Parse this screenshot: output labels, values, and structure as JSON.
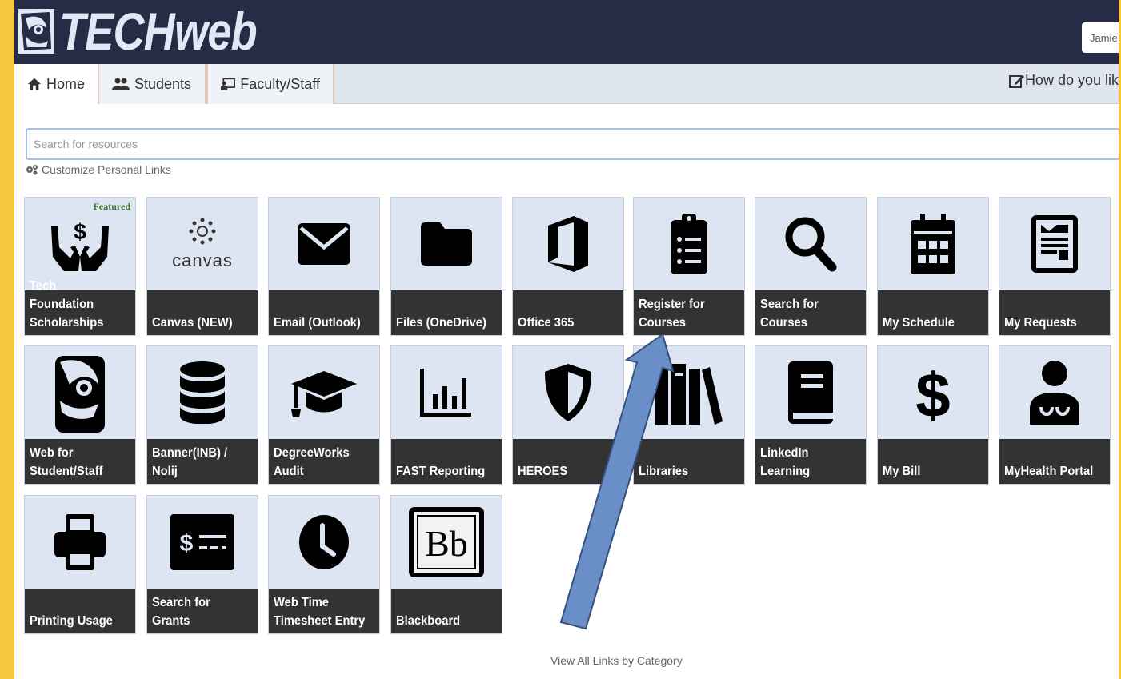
{
  "header": {
    "logo_text": "TECHweb",
    "user_label": "Jamie"
  },
  "nav": {
    "tabs": [
      {
        "label": "Home",
        "icon": "home-icon",
        "active": true
      },
      {
        "label": "Students",
        "icon": "users-icon",
        "active": false
      },
      {
        "label": "Faculty/Staff",
        "icon": "chalkboard-icon",
        "active": false
      }
    ],
    "feedback_label": "How do you lik"
  },
  "search": {
    "placeholder": "Search for resources"
  },
  "customize_label": "Customize Personal Links",
  "tiles": [
    {
      "label": "Tech Foundation\nScholarships",
      "icon": "hands-dollar-icon",
      "badge": "Featured"
    },
    {
      "label": "Canvas (NEW)",
      "icon": "canvas-logo-icon",
      "sub": "canvas"
    },
    {
      "label": "Email (Outlook)",
      "icon": "envelope-icon"
    },
    {
      "label": "Files (OneDrive)",
      "icon": "folder-icon"
    },
    {
      "label": "Office 365",
      "icon": "office-icon"
    },
    {
      "label": "Register for\nCourses",
      "icon": "clipboard-list-icon"
    },
    {
      "label": "Search for\nCourses",
      "icon": "magnifier-icon"
    },
    {
      "label": "My Schedule",
      "icon": "calendar-icon"
    },
    {
      "label": "My Requests",
      "icon": "form-icon"
    },
    {
      "label": "Web for\nStudent/Staff",
      "icon": "owl-icon"
    },
    {
      "label": "Banner(INB) /\nNolij",
      "icon": "database-icon"
    },
    {
      "label": "DegreeWorks\nAudit",
      "icon": "graduation-cap-icon"
    },
    {
      "label": "FAST Reporting",
      "icon": "bar-chart-icon"
    },
    {
      "label": "HEROES",
      "icon": "shield-icon"
    },
    {
      "label": "Libraries",
      "icon": "books-icon"
    },
    {
      "label": "LinkedIn\nLearning",
      "icon": "book-icon"
    },
    {
      "label": "My Bill",
      "icon": "dollar-icon"
    },
    {
      "label": "MyHealth Portal",
      "icon": "doctor-icon"
    },
    {
      "label": "Printing Usage",
      "icon": "printer-icon"
    },
    {
      "label": "Search for\nGrants",
      "icon": "money-bill-icon"
    },
    {
      "label": "Web Time\nTimesheet Entry",
      "icon": "clock-icon"
    },
    {
      "label": "Blackboard",
      "icon": "blackboard-logo-icon",
      "sub": "Bb"
    }
  ],
  "footer_link": "View All Links by Category",
  "colors": {
    "topbar": "#262c45",
    "border_frame": "#f6c63c",
    "tile_bg": "#dce5f1",
    "tile_label": "#333333",
    "arrow": "#6a8fc8"
  }
}
